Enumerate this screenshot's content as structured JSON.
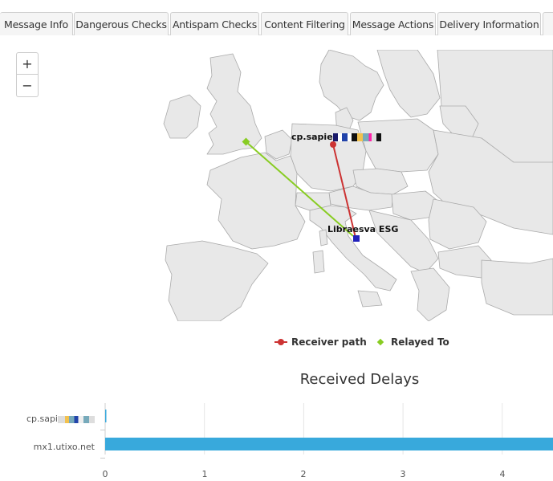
{
  "tabs": [
    {
      "label": "Message Info"
    },
    {
      "label": "Dangerous Checks"
    },
    {
      "label": "Antispam Checks"
    },
    {
      "label": "Content Filtering"
    },
    {
      "label": "Message Actions"
    },
    {
      "label": "Delivery Information"
    }
  ],
  "map": {
    "zoom_in_label": "+",
    "zoom_out_label": "−",
    "markers": [
      {
        "label": "cp.sapie",
        "color": "#cc3333"
      },
      {
        "label": "Libraesva ESG",
        "color": "#2222bb"
      }
    ],
    "legend": [
      {
        "label": "Receiver path",
        "color": "#cc3333"
      },
      {
        "label": "Relayed To",
        "color": "#88cc22"
      }
    ]
  },
  "chart_data": {
    "type": "bar",
    "title": "Received Delays",
    "categories": [
      "cp.sapi",
      "mx1.utixo.net"
    ],
    "values": [
      0.01,
      4.6
    ],
    "x_ticks": [
      "0",
      "1",
      "2",
      "3",
      "4"
    ],
    "xlim": [
      0,
      4.6
    ],
    "bar_color": "#38a9dc",
    "grid": true
  }
}
